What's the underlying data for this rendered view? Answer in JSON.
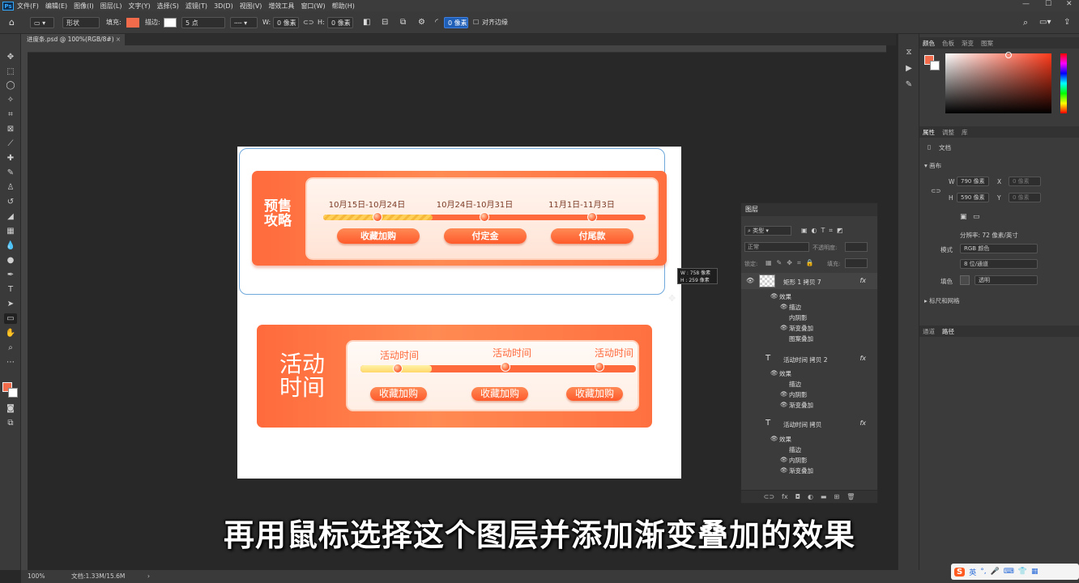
{
  "menubar": {
    "logo": "Ps",
    "items": [
      "文件(F)",
      "编辑(E)",
      "图像(I)",
      "图层(L)",
      "文字(Y)",
      "选择(S)",
      "滤镜(T)",
      "3D(D)",
      "视图(V)",
      "增效工具",
      "窗口(W)",
      "帮助(H)"
    ]
  },
  "options": {
    "shape_mode": "形状",
    "fill_label": "填充:",
    "fill_color": "#f26b4a",
    "stroke_label": "描边:",
    "stroke_size": "5 点",
    "w_label": "W:",
    "w_value": "0 像素",
    "h_label": "H:",
    "h_value": "0 像素",
    "radius_value": "0 像素",
    "align_edges": "对齐边缘"
  },
  "document": {
    "tab_title": "进度条.psd @ 100%(RGB/8#)"
  },
  "canvas": {
    "banner1": {
      "title_line1": "预售",
      "title_line2": "攻略",
      "dates": [
        "10月15日-10月24日",
        "10月24日-10月31日",
        "11月1日-11月3日"
      ],
      "buttons": [
        "收藏加购",
        "付定金",
        "付尾款"
      ],
      "progress": 0.34
    },
    "banner2": {
      "title_line1": "活动",
      "title_line2": "时间",
      "dates": [
        "活动时间",
        "活动时间",
        "活动时间"
      ],
      "buttons": [
        "收藏加购",
        "收藏加购",
        "收藏加购"
      ],
      "progress": 0.26
    },
    "size_tip": {
      "w": "W : 758 像素",
      "h": "H : 259 像素"
    }
  },
  "layers": {
    "title": "图层",
    "filter_kind": "类型",
    "blend_mode": "正常",
    "opacity_label": "不透明度:",
    "lock_label": "锁定:",
    "fill_label": "填充:",
    "items": [
      {
        "name": "矩形 1 拷贝 7",
        "fx": "fx",
        "effects_label": "效果",
        "effects": [
          "描边",
          "内阴影",
          "渐变叠加",
          "图案叠加"
        ]
      },
      {
        "name": "活动时间 拷贝 2",
        "fx": "fx",
        "effects_label": "效果",
        "effects": [
          "描边",
          "内阴影",
          "渐变叠加"
        ]
      },
      {
        "name": "活动时间 拷贝",
        "fx": "fx",
        "effects_label": "效果",
        "effects": [
          "描边",
          "内阴影",
          "渐变叠加"
        ]
      }
    ]
  },
  "right_dock": {
    "color_tabs": [
      "颜色",
      "色板",
      "渐变",
      "图案"
    ],
    "prop_tabs": [
      "属性",
      "调整",
      "库"
    ],
    "doc_label": "文档",
    "canvas_section": "画布",
    "w_label": "W",
    "w_value": "790 像素",
    "h_label": "H",
    "h_value": "590 像素",
    "x_label": "X",
    "x_value": "0 像素",
    "y_label": "Y",
    "y_value": "0 像素",
    "resolution": "分辨率: 72 像素/英寸",
    "mode_label": "模式",
    "mode_value": "RGB 颜色",
    "depth_value": "8 位/通道",
    "fill_label": "填色",
    "fill_value": "透明",
    "rulers_section": "标尺和网格",
    "bottom_tabs": [
      "通道",
      "路径"
    ]
  },
  "status": {
    "zoom": "100%",
    "doc_info": "文档:1.33M/15.6M"
  },
  "subtitle": "再用鼠标选择这个图层并添加渐变叠加的效果",
  "ime": {
    "logo": "S",
    "lang": "英"
  }
}
